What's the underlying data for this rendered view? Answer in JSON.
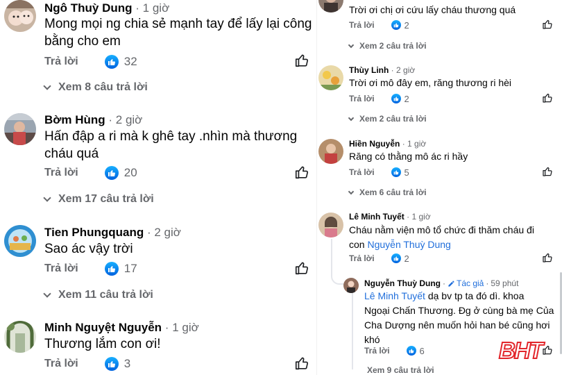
{
  "left_comments": [
    {
      "name": "Ngô Thuỳ Dung",
      "time": "1 giờ",
      "lines": [
        "Mong mọi ng chia sẻ mạnh tay để lấy lại công",
        "bằng cho em"
      ],
      "reply_label": "Trả lời",
      "likes": "32",
      "replies_link": "Xem 8 câu trả lời",
      "avatar_icon": "child-photo-avatar"
    },
    {
      "name": "Bờm Hùng",
      "time": "2 giờ",
      "lines": [
        "Hấn đập a ri mà k ghê tay .nhìn mà thương",
        "cháu quá"
      ],
      "reply_label": "Trả lời",
      "likes": "20",
      "replies_link": "Xem 17 câu trả lời",
      "avatar_icon": "person-photo-avatar"
    },
    {
      "name": "Tien Phungquang",
      "time": "2 giờ",
      "lines": [
        "Sao ác vậy trời"
      ],
      "reply_label": "Trả lời",
      "likes": "17",
      "replies_link": "Xem 11 câu trả lời",
      "avatar_icon": "illustration-avatar"
    },
    {
      "name": "Minh Nguyệt Nguyễn",
      "time": "1 giờ",
      "lines": [
        "Thương lắm con ơi!"
      ],
      "reply_label": "Trả lời",
      "likes": "3",
      "replies_link": "",
      "avatar_icon": "garden-photo-avatar"
    }
  ],
  "right_comments": [
    {
      "name": "",
      "time": "",
      "lines": [
        "Trời ơi chị ơi cứu lấy cháu thương quá"
      ],
      "reply_label": "Trả lời",
      "likes": "2",
      "replies_link": "Xem 2 câu trả lời",
      "avatar_icon": "partial-avatar"
    },
    {
      "name": "Thùy Linh",
      "time": "2 giờ",
      "lines": [
        "Trời ơi mô đây em, răng thương ri hèi"
      ],
      "reply_label": "Trả lời",
      "likes": "2",
      "replies_link": "Xem 2 câu trả lời",
      "avatar_icon": "flower-avatar"
    },
    {
      "name": "Hiền Nguyễn",
      "time": "1 giờ",
      "lines": [
        "Răng có thằng mô ác ri hầy"
      ],
      "reply_label": "Trả lời",
      "likes": "5",
      "replies_link": "Xem 6 câu trả lời",
      "avatar_icon": "person-photo-avatar"
    },
    {
      "name": "Lê Minh Tuyết",
      "time": "1 giờ",
      "line1": "Cháu nằm viện mô tổ chức đi thăm cháu đi",
      "line2_prefix": "con ",
      "mention": "Nguyễn Thuỳ Dung",
      "reply_label": "Trả lời",
      "likes": "2",
      "avatar_icon": "woman-photo-avatar"
    }
  ],
  "nested_reply": {
    "name": "Nguyễn Thuỳ Dung",
    "author_label": "Tác giả",
    "time": "59 phút",
    "mention": "Lê Minh Tuyết",
    "line1_rest": " dạ bv tp ta đó dì. khoa",
    "lines": [
      "Ngoại Chấn Thương. Đg ở cùng bà mẹ Của",
      "Cha Dượng nên muốn hỏi han bé cũng hơi",
      "khó"
    ],
    "reply_label": "Trả lời",
    "likes": "6",
    "replies_link": "Xem 9 câu trả lời"
  },
  "watermark": "BHT",
  "colors": {
    "link_blue": "#216fdb",
    "meta_gray": "#65676b",
    "like_blue": "#0866ff",
    "watermark_red": "#e2262b"
  }
}
